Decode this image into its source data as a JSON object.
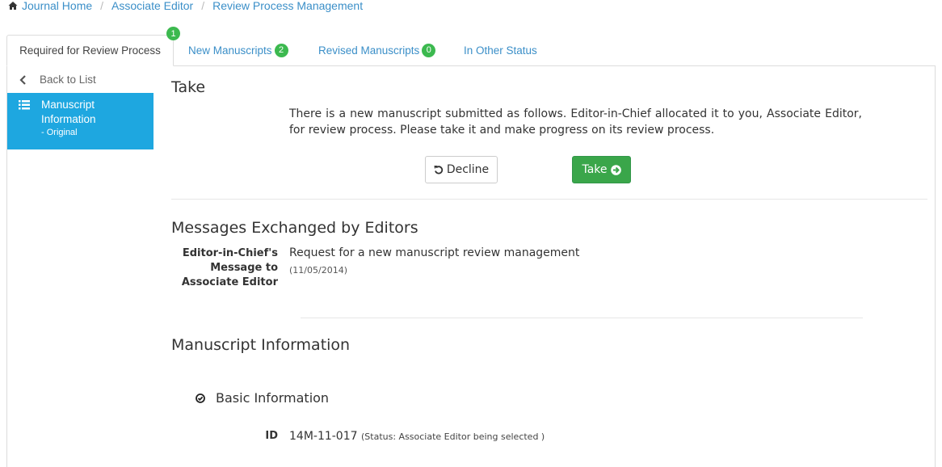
{
  "breadcrumb": {
    "items": [
      "Journal Home",
      "Associate Editor",
      "Review Process Management"
    ],
    "separator": "/"
  },
  "tabs": {
    "active": "Required for Review Process",
    "active_badge": "1",
    "new_manuscripts": "New Manuscripts",
    "new_count": "2",
    "revised_manuscripts": "Revised Manuscripts",
    "revised_count": "0",
    "other_status": "In Other Status"
  },
  "sidebar": {
    "back_label": "Back to List",
    "active_item_title": "Manuscript Information",
    "active_item_sub": "- Original"
  },
  "take_section": {
    "heading": "Take",
    "message": "There is a new manuscript submitted as follows. Editor-in-Chief allocated it to you, Associate Editor, for review process. Please take it and make progress on its review process.",
    "decline_label": "Decline",
    "take_label": "Take"
  },
  "messages_section": {
    "heading": "Messages Exchanged by Editors",
    "label": "Editor-in-Chief's Message to Associate Editor",
    "subject": "Request for a new manuscript review management",
    "date": "(11/05/2014)"
  },
  "manuscript_info": {
    "heading": "Manuscript Information",
    "basic_heading": "Basic Information",
    "id_label": "ID",
    "id_value": "14M-11-017",
    "status": "(Status: Associate Editor being selected )"
  },
  "colors": {
    "link": "#3b8fc8",
    "badge_green": "#3cb94f",
    "sidebar_active": "#1ea7e0",
    "take_button": "#3aa64a"
  }
}
